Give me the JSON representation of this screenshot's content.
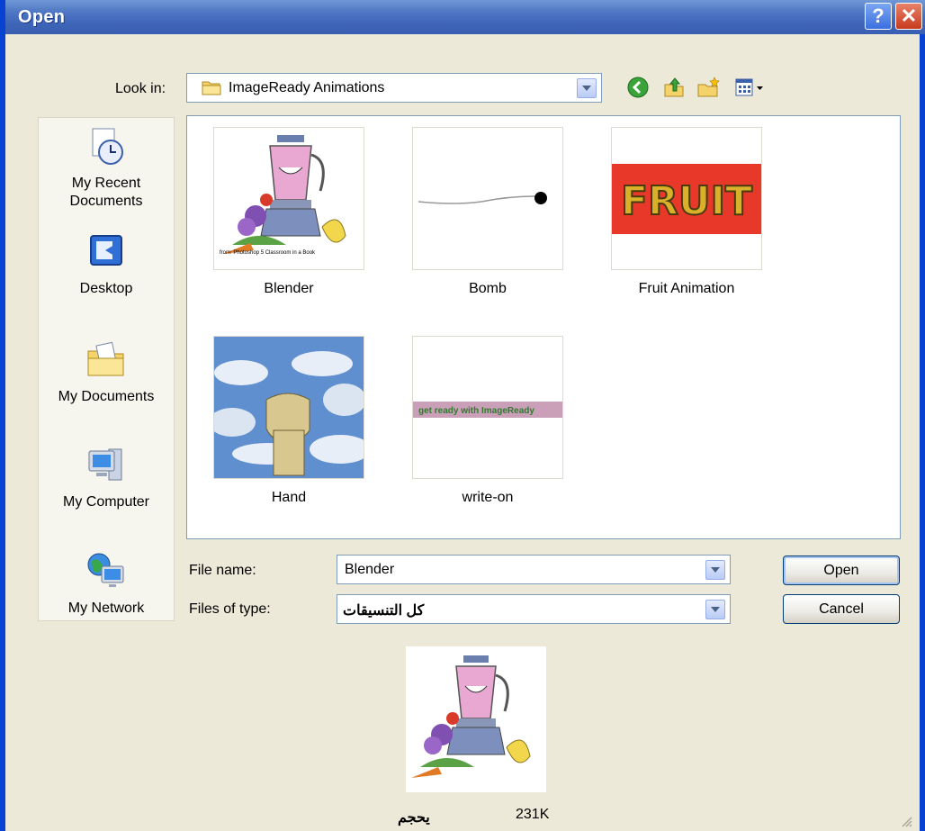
{
  "window": {
    "title": "Open",
    "help_glyph": "?",
    "close_glyph": "✕"
  },
  "toolbar": {
    "look_in_label": "Look in:",
    "look_in_value": "ImageReady Animations",
    "back_icon": "back-arrow-icon",
    "up_icon": "up-folder-icon",
    "new_folder_icon": "new-folder-icon",
    "views_icon": "views-menu-icon"
  },
  "places": [
    {
      "label": "My Recent Documents",
      "icon": "recent-documents-icon"
    },
    {
      "label": "Desktop",
      "icon": "desktop-icon"
    },
    {
      "label": "My Documents",
      "icon": "my-documents-icon"
    },
    {
      "label": "My Computer",
      "icon": "my-computer-icon"
    },
    {
      "label": "My Network",
      "icon": "my-network-icon"
    }
  ],
  "files": [
    {
      "name": "Blender",
      "thumb": "blender-thumbnail",
      "caption": "from: Photoshop 5 Classroom in a Book"
    },
    {
      "name": "Bomb",
      "thumb": "bomb-thumbnail"
    },
    {
      "name": "Fruit Animation",
      "thumb": "fruit-thumbnail",
      "banner": "FRUIT"
    },
    {
      "name": "Hand",
      "thumb": "hand-thumbnail"
    },
    {
      "name": "write-on",
      "thumb": "write-on-thumbnail",
      "banner": "get ready with ImageReady"
    }
  ],
  "form": {
    "file_name_label": "File name:",
    "file_name_value": "Blender",
    "file_type_label": "Files of type:",
    "file_type_value": "كل التنسيقات"
  },
  "buttons": {
    "open": "Open",
    "cancel": "Cancel"
  },
  "preview": {
    "label": "يحجم",
    "size": "231K"
  },
  "colors": {
    "titlebar": "#3e64b8",
    "frame": "#0842d2",
    "dialog_bg": "#ece9d8"
  }
}
